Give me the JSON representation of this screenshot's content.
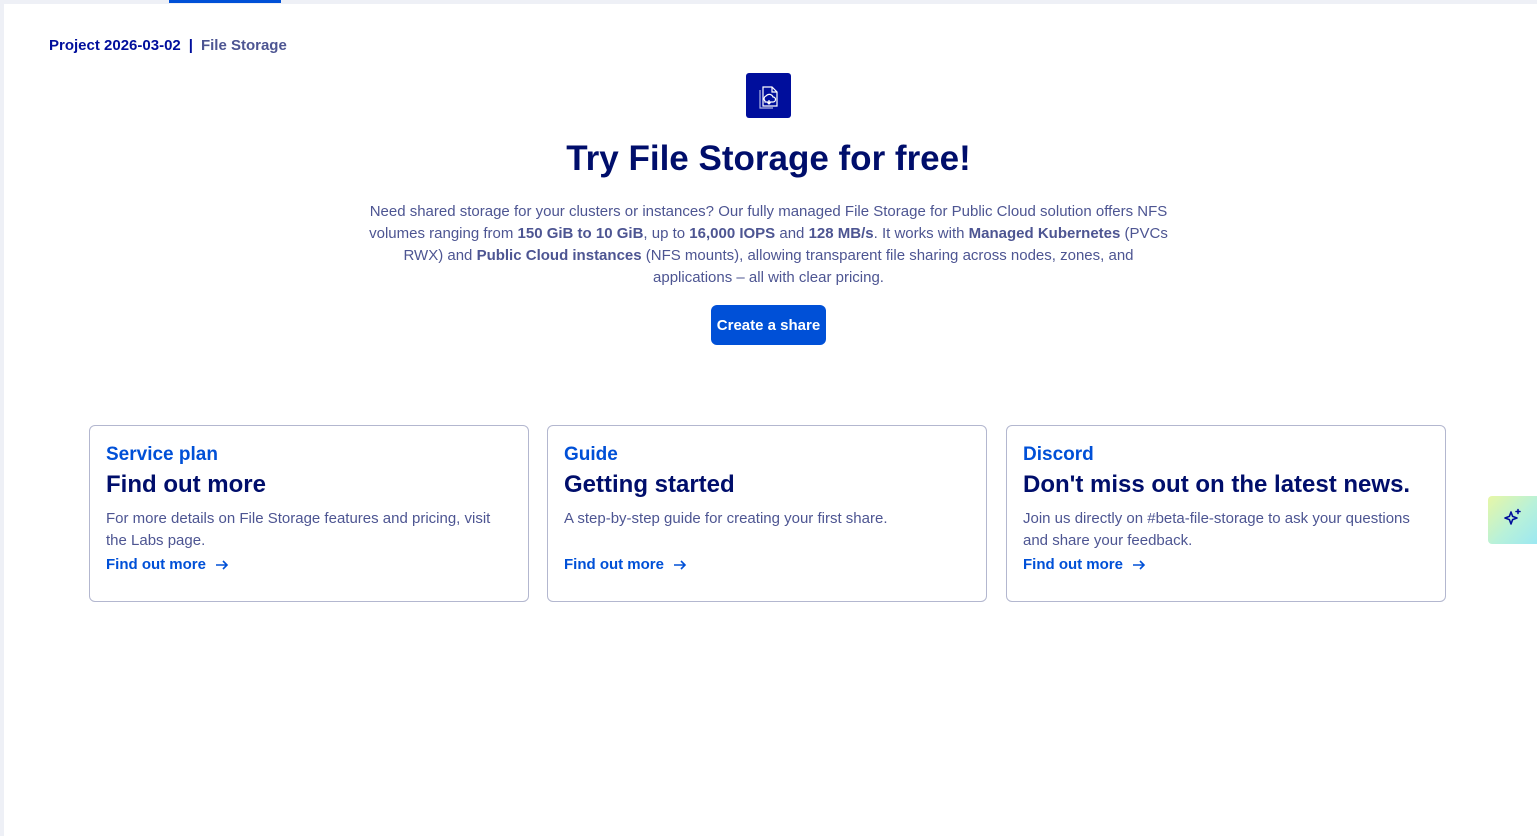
{
  "breadcrumb": {
    "project": "Project 2026-03-02",
    "separator": "|",
    "current": "File Storage"
  },
  "hero": {
    "icon": "file-storage-cloud-icon",
    "title": "Try File Storage for free!",
    "description": {
      "p1": "Need shared storage for your clusters or instances? Our fully managed File Storage for Public Cloud solution offers NFS volumes ranging from ",
      "b1": "150 GiB to 10 GiB",
      "p2": ", up to ",
      "b2": "16,000 IOPS",
      "p3": " and ",
      "b3": "128 MB/s",
      "p4": ". It works with ",
      "b4": "Managed Kubernetes",
      "p5": " (PVCs RWX) and ",
      "b5": "Public Cloud instances",
      "p6": " (NFS mounts), allowing transparent file sharing across nodes, zones, and applications – all with clear pricing."
    },
    "cta_label": "Create a share"
  },
  "cards": [
    {
      "kicker": "Service plan",
      "title": "Find out more",
      "body": "For more details on File Storage features and pricing, visit the Labs page.",
      "link": "Find out more"
    },
    {
      "kicker": "Guide",
      "title": "Getting started",
      "body": "A step-by-step guide for creating your first share.",
      "link": "Find out more"
    },
    {
      "kicker": "Discord",
      "title": "Don't miss out on the latest news.",
      "body": "Join us directly on #beta-file-storage to ask your questions and share your feedback.",
      "link": "Find out more"
    }
  ],
  "assistant_button_icon": "sparkle-icon",
  "colors": {
    "primary": "#0050d7",
    "heading": "#000e6b",
    "text": "#4d5592",
    "icon_bg": "#000e9c"
  }
}
